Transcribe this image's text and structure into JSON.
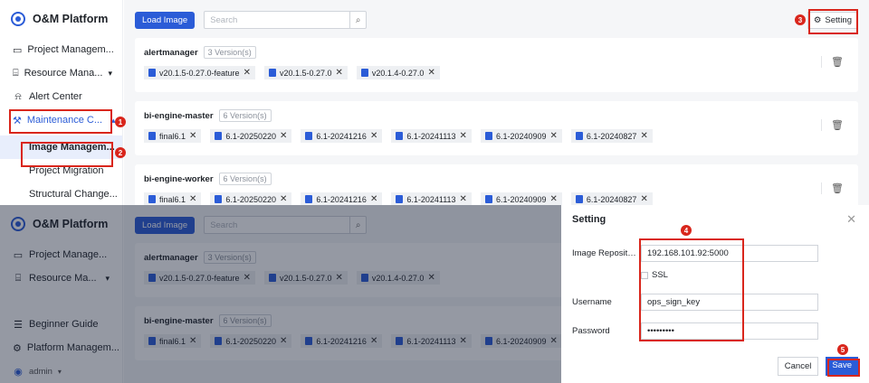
{
  "app": {
    "title": "O&M Platform"
  },
  "sidebar_top": {
    "items": [
      {
        "label": "Project Managem...",
        "icon": "monitor-icon"
      },
      {
        "label": "Resource Mana...",
        "icon": "chart-icon"
      },
      {
        "label": "Alert Center",
        "icon": "bell-icon"
      },
      {
        "label": "Maintenance C...",
        "icon": "wrench-icon"
      }
    ],
    "sub_items": [
      "Image Managem...",
      "Project Migration",
      "Structural Change..."
    ]
  },
  "toolbar": {
    "load_label": "Load Image",
    "search_placeholder": "Search",
    "setting_label": "Setting"
  },
  "images": [
    {
      "name": "alertmanager",
      "count": "3 Version(s)",
      "tags": [
        "v20.1.5-0.27.0-feature",
        "v20.1.5-0.27.0",
        "v20.1.4-0.27.0"
      ]
    },
    {
      "name": "bi-engine-master",
      "count": "6 Version(s)",
      "tags": [
        "final6.1",
        "6.1-20250220",
        "6.1-20241216",
        "6.1-20241113",
        "6.1-20240909",
        "6.1-20240827"
      ]
    },
    {
      "name": "bi-engine-worker",
      "count": "6 Version(s)",
      "tags": [
        "final6.1",
        "6.1-20250220",
        "6.1-20241216",
        "6.1-20241113",
        "6.1-20240909",
        "6.1-20240827"
      ]
    }
  ],
  "sidebar_bottom": {
    "items": [
      {
        "label": "Project Manage...",
        "icon": "monitor-icon"
      },
      {
        "label": "Resource Ma...",
        "icon": "chart-icon"
      }
    ],
    "footer": [
      {
        "label": "Beginner Guide",
        "icon": "guide-icon"
      },
      {
        "label": "Platform Managem...",
        "icon": "gear-icon"
      },
      {
        "label": "admin",
        "icon": "user-icon"
      }
    ]
  },
  "modal": {
    "title": "Setting",
    "repo_label": "Image Repository ...",
    "repo_value": "192.168.101.92:5000",
    "ssl_label": "SSL",
    "username_label": "Username",
    "username_value": "ops_sign_key",
    "password_label": "Password",
    "password_value": "•••••••••",
    "cancel_label": "Cancel",
    "save_label": "Save"
  },
  "annotations": [
    "1",
    "2",
    "3",
    "4",
    "5"
  ],
  "colors": {
    "accent": "#2b5cd7",
    "highlight": "#d9261c"
  }
}
